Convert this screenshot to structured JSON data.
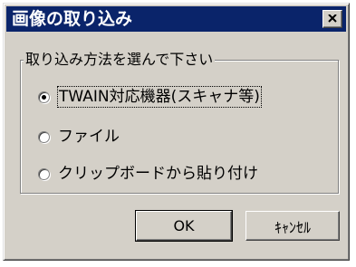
{
  "dialog": {
    "title": "画像の取り込み",
    "close_icon": "close-icon"
  },
  "group": {
    "label": "取り込み方法を選んで下さい",
    "options": [
      {
        "label": "TWAIN対応機器(スキャナ等)",
        "selected": true
      },
      {
        "label": "ファイル",
        "selected": false
      },
      {
        "label": "クリップボードから貼り付け",
        "selected": false
      }
    ]
  },
  "buttons": {
    "ok": "OK",
    "cancel": "ｷｬﾝｾﾙ"
  }
}
